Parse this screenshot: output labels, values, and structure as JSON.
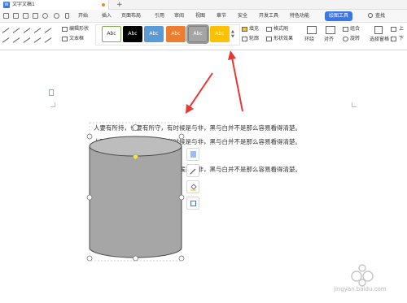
{
  "titlebar": {
    "doc_icon": "W",
    "doc_title": "文字文稿1",
    "add_tab": "+"
  },
  "menu": {
    "items": [
      "开始",
      "插入",
      "页面布局",
      "引用",
      "审阅",
      "视图",
      "章节",
      "安全",
      "开发工具",
      "特色功能",
      "绘图工具",
      "查找"
    ],
    "active": "绘图工具"
  },
  "ribbon": {
    "edit_shape": "编辑形状",
    "text_box": "文本框",
    "style_label": "Abc",
    "styles": [
      {
        "bg": "#ffffff",
        "fg": "#333333",
        "border": "#7fb14f"
      },
      {
        "bg": "#000000",
        "fg": "#ffffff",
        "border": "#000000"
      },
      {
        "bg": "#5b9bd5",
        "fg": "#ffffff",
        "border": "#5b9bd5"
      },
      {
        "bg": "#ed7d31",
        "fg": "#ffffff",
        "border": "#ed7d31"
      },
      {
        "bg": "#a5a5a5",
        "fg": "#ffffff",
        "border": "#7f7f7f"
      },
      {
        "bg": "#ffc000",
        "fg": "#ffffff",
        "border": "#ffc000"
      }
    ],
    "fill": "填充",
    "format_painter": "格式刷",
    "outline": "轮廓",
    "shape_effects": "形状效果",
    "wrap": "环绕",
    "align": "对齐",
    "group": "组合",
    "rotate": "旋转",
    "select_pane": "选择窗格",
    "bring_up": "上",
    "bring_down": "下"
  },
  "document": {
    "lines": [
      "人要有所持，也要有所守，有时候是与非，黑与白并不是那么容易看得清楚。",
      "人要有所持，也要有所守，有时候是与非，黑与白并不是那么容易看得清楚。",
      "人要有所持，也要有所守，有时候是与非，黑与白并不是那么容易看得清楚。"
    ],
    "shape_fill": "#a6a6a6",
    "shape_stroke": "#4a4a4a"
  },
  "watermark": {
    "text": "jingyan.baidu.com"
  },
  "colors": {
    "accent": "#3b78e7",
    "arrow": "#e53935"
  }
}
